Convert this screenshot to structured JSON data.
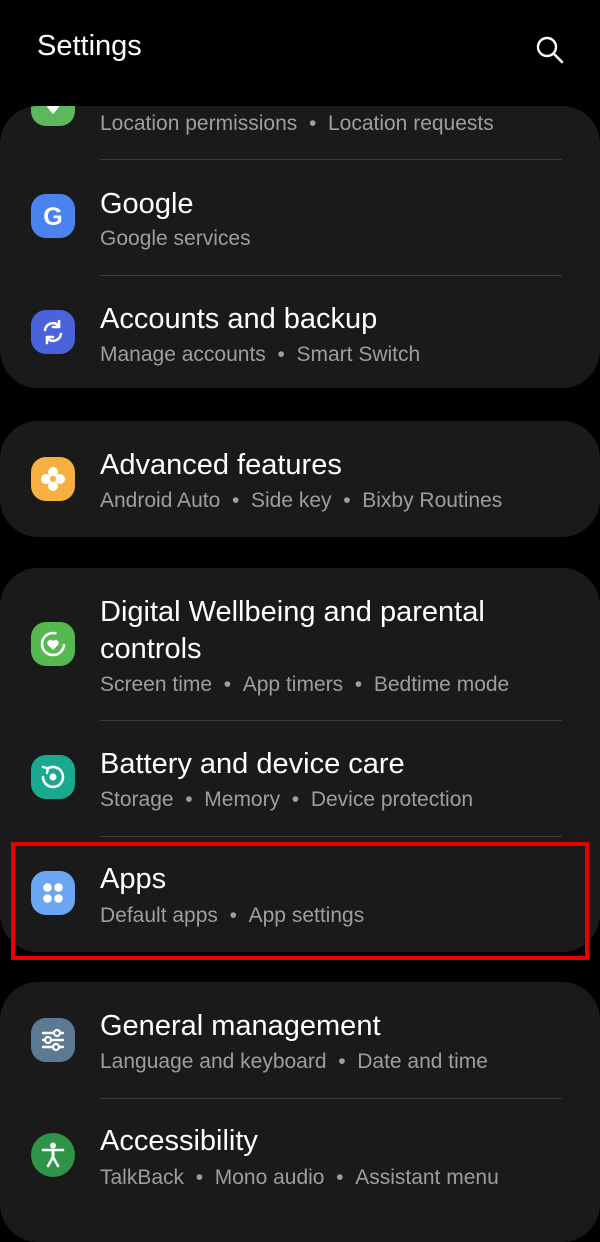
{
  "header": {
    "title": "Settings"
  },
  "items": {
    "location": {
      "subtitle_parts": [
        "Location permissions",
        "Location requests"
      ]
    },
    "google": {
      "title": "Google",
      "subtitle": "Google services"
    },
    "accounts": {
      "title": "Accounts and backup",
      "subtitle_parts": [
        "Manage accounts",
        "Smart Switch"
      ]
    },
    "advanced": {
      "title": "Advanced features",
      "subtitle_parts": [
        "Android Auto",
        "Side key",
        "Bixby Routines"
      ]
    },
    "wellbeing": {
      "title_line1": "Digital Wellbeing and parental",
      "title_line2": "controls",
      "subtitle_parts": [
        "Screen time",
        "App timers",
        "Bedtime mode"
      ]
    },
    "battery": {
      "title": "Battery and device care",
      "subtitle_parts": [
        "Storage",
        "Memory",
        "Device protection"
      ]
    },
    "apps": {
      "title": "Apps",
      "subtitle_parts": [
        "Default apps",
        "App settings"
      ]
    },
    "general": {
      "title": "General management",
      "subtitle_parts": [
        "Language and keyboard",
        "Date and time"
      ]
    },
    "accessibility": {
      "title": "Accessibility",
      "subtitle_parts": [
        "TalkBack",
        "Mono audio",
        "Assistant menu"
      ]
    }
  },
  "separator": "•",
  "colors": {
    "location": "#5cb85c",
    "google": "#4a82f0",
    "accounts": "#4a63dd",
    "advanced": "#f5b041",
    "wellbeing": "#56b94f",
    "battery": "#19a98f",
    "apps": "#6aa6f2",
    "general": "#5d7892",
    "accessibility": "#2f9447",
    "highlight": "#e60000"
  }
}
